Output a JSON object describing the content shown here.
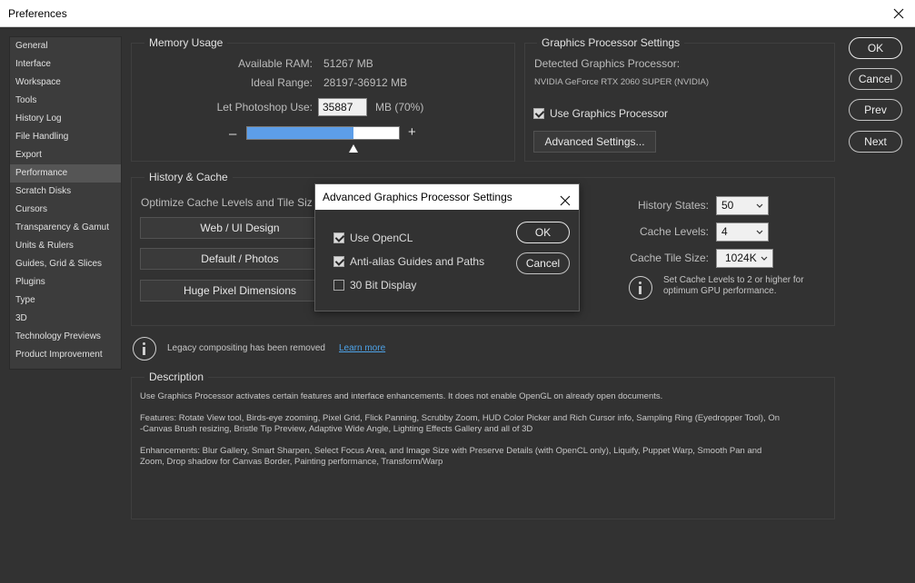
{
  "window": {
    "title": "Preferences"
  },
  "sidebar": {
    "items": [
      {
        "label": "General"
      },
      {
        "label": "Interface"
      },
      {
        "label": "Workspace"
      },
      {
        "label": "Tools"
      },
      {
        "label": "History Log"
      },
      {
        "label": "File Handling"
      },
      {
        "label": "Export"
      },
      {
        "label": "Performance"
      },
      {
        "label": "Scratch Disks"
      },
      {
        "label": "Cursors"
      },
      {
        "label": "Transparency & Gamut"
      },
      {
        "label": "Units & Rulers"
      },
      {
        "label": "Guides, Grid & Slices"
      },
      {
        "label": "Plugins"
      },
      {
        "label": "Type"
      },
      {
        "label": "3D"
      },
      {
        "label": "Technology Previews"
      },
      {
        "label": "Product Improvement"
      }
    ],
    "selected": "Performance"
  },
  "memory": {
    "title": "Memory Usage",
    "available_label": "Available RAM:",
    "available_value": "51267 MB",
    "ideal_label": "Ideal Range:",
    "ideal_value": "28197-36912 MB",
    "use_label": "Let Photoshop Use:",
    "use_value": "35887",
    "use_unit": "MB (70%)",
    "slider_fraction": 0.7,
    "minus": "–",
    "plus": "+"
  },
  "gpu": {
    "title": "Graphics Processor Settings",
    "detected_label": "Detected Graphics Processor:",
    "detected_value": "NVIDIA GeForce RTX 2060 SUPER (NVIDIA)",
    "use_gpu_label": "Use Graphics Processor",
    "use_gpu_checked": true,
    "advanced_button": "Advanced Settings..."
  },
  "buttons": {
    "ok": "OK",
    "cancel": "Cancel",
    "prev": "Prev",
    "next": "Next"
  },
  "history_cache": {
    "title": "History & Cache",
    "optimize_label": "Optimize Cache Levels and Tile Siz",
    "presets": [
      "Web / UI Design",
      "Default / Photos",
      "Huge Pixel Dimensions"
    ],
    "history_states_label": "History States:",
    "history_states_value": "50",
    "cache_levels_label": "Cache Levels:",
    "cache_levels_value": "4",
    "cache_tile_label": "Cache Tile Size:",
    "cache_tile_value": "1024K",
    "hint_line1": "Set Cache Levels to 2 or higher for",
    "hint_line2": "optimum GPU performance."
  },
  "legacy": {
    "text": "Legacy compositing has been removed",
    "link": "Learn more"
  },
  "description": {
    "title": "Description",
    "p1": "Use Graphics Processor activates certain features and interface enhancements. It does not enable OpenGL on already open documents.",
    "p2a": "Features: Rotate View tool, Birds-eye zooming, Pixel Grid, Flick Panning, Scrubby Zoom, HUD Color Picker and Rich Cursor info, Sampling Ring (Eyedropper Tool), On",
    "p2b": "-Canvas Brush resizing, Bristle Tip Preview, Adaptive Wide Angle, Lighting Effects Gallery and all of 3D",
    "p3a": "Enhancements: Blur Gallery, Smart Sharpen, Select Focus Area, and Image Size with Preserve Details (with OpenCL only), Liquify, Puppet Warp, Smooth Pan and",
    "p3b": "Zoom, Drop shadow for Canvas Border, Painting performance, Transform/Warp"
  },
  "modal": {
    "title": "Advanced Graphics Processor Settings",
    "opencl_label": "Use OpenCL",
    "opencl_checked": true,
    "antialias_label": "Anti-alias Guides and Paths",
    "antialias_checked": true,
    "bit30_label": "30 Bit Display",
    "bit30_checked": false,
    "ok": "OK",
    "cancel": "Cancel"
  },
  "colors": {
    "background": "#323232",
    "slider_fill": "#5d9ee8",
    "link": "#4ea3e8"
  }
}
